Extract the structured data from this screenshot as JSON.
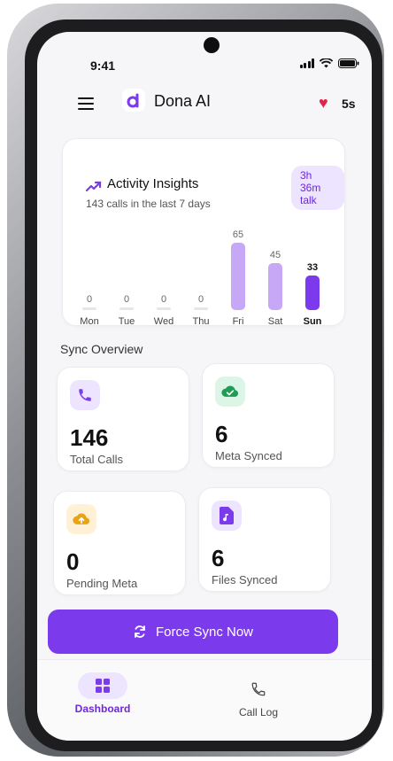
{
  "status_bar": {
    "time": "9:41"
  },
  "header": {
    "app_title": "Dona AI",
    "streak": "5s",
    "logo_letter": "d"
  },
  "insights": {
    "title": "Activity Insights",
    "subtitle": "143 calls in the last 7 days",
    "talk_time": "3h 36m talk",
    "bars": [
      {
        "day": "Mon",
        "value": "0"
      },
      {
        "day": "Tue",
        "value": "0"
      },
      {
        "day": "Wed",
        "value": "0"
      },
      {
        "day": "Thu",
        "value": "0"
      },
      {
        "day": "Fri",
        "value": "65"
      },
      {
        "day": "Sat",
        "value": "45"
      },
      {
        "day": "Sun",
        "value": "33"
      }
    ]
  },
  "sync": {
    "section_title": "Sync Overview",
    "stats": [
      {
        "number": "146",
        "label": "Total Calls",
        "icon": "phone-icon"
      },
      {
        "number": "6",
        "label": "Meta Synced",
        "icon": "cloud-check-icon"
      },
      {
        "number": "0",
        "label": "Pending Meta",
        "icon": "cloud-upload-icon"
      },
      {
        "number": "6",
        "label": "Files Synced",
        "icon": "music-file-icon"
      }
    ],
    "button_label": "Force Sync Now"
  },
  "nav": {
    "items": [
      {
        "label": "Dashboard",
        "icon": "grid-icon"
      },
      {
        "label": "Call Log",
        "icon": "phone-icon"
      }
    ]
  },
  "colors": {
    "accent": "#7c3aed",
    "accent_light": "#ede4ff",
    "heart": "#e0264a"
  }
}
